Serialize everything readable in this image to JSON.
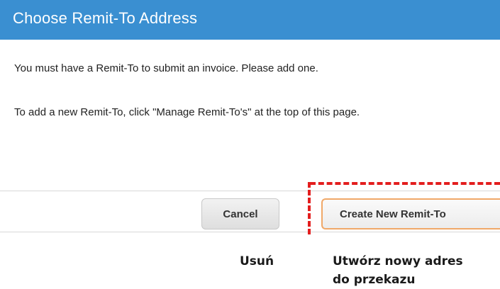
{
  "dialog": {
    "title": "Choose Remit-To Address",
    "message_1": "You must have a Remit-To to submit an invoice. Please add one.",
    "message_2": "To add a new Remit-To, click \"Manage Remit-To's\" at the top of this page."
  },
  "footer": {
    "cancel_label": "Cancel",
    "create_label": "Create New Remit-To"
  },
  "annotations": {
    "cancel_caption": "Usuń",
    "create_caption_line_1": "Utwórz nowy adres",
    "create_caption_line_2": "do przekazu"
  },
  "colors": {
    "header_background": "#3a8fd1",
    "highlight": "#e31e1e",
    "create_button_border": "#f0a868"
  }
}
